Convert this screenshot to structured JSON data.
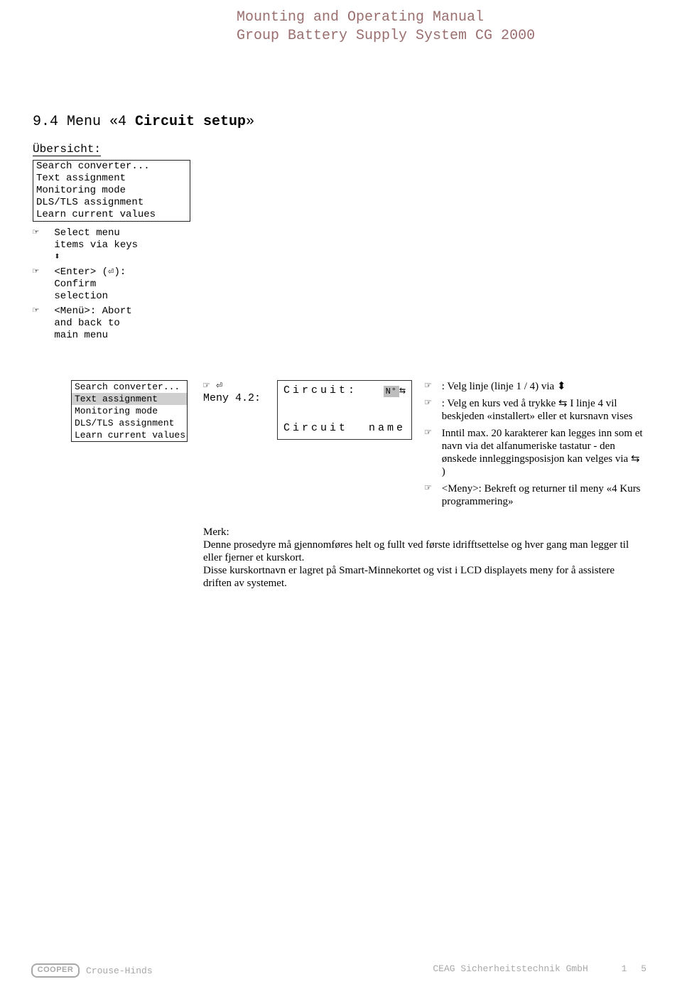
{
  "header": {
    "line1": "Mounting and Operating Manual",
    "line2": "Group Battery Supply System CG 2000"
  },
  "section": {
    "num": "9.4 Menu «4 ",
    "bold": "Circuit setup",
    "close": "»"
  },
  "ubersicht": "Übersicht:",
  "menu1": {
    "r1": "Search converter...",
    "r2": "Text assignment",
    "r3": "Monitoring mode",
    "r4": "DLS/TLS assignment",
    "r5": "Learn current values"
  },
  "bul1": {
    "b1a": "Select menu",
    "b1b": "items via keys",
    "b1c": "⬍",
    "b2a": "<Enter> (⏎):",
    "b2b": "Confirm",
    "b2c": "selection",
    "b3a": "<Menü>: Abort",
    "b3b": "and back to",
    "b3c": "main menu"
  },
  "menu2": {
    "r1": "Search converter...",
    "r2": "Text assignment",
    "r3": "Monitoring mode",
    "r4": "DLS/TLS assignment",
    "r5": "Learn current values"
  },
  "meny": {
    "hand": "☞ ⏎",
    "label": "Meny 4.2:"
  },
  "lcd": {
    "l1_left": "Circuit:",
    "l1_badge": "N°",
    "l1_arrow": "⇆",
    "l2_left": "Circuit",
    "l2_right": "name"
  },
  "rnotes": {
    "n1": ": Velg linje (linje 1 / 4) via  ⬍",
    "n2": ": Velg en kurs ved å trykke  ⇆ I linje 4 vil beskjeden «installert» eller et kursnavn vises",
    "n3": "Inntil max. 20 karakterer kan legges inn som et navn via det alfanumeriske tastatur - den ønskede innleggingsposisjon kan velges via  ⇆ )",
    "n4": "<Meny>: Bekreft og returner til meny «4 Kurs programmering»"
  },
  "merk": {
    "label": "Merk:",
    "p": "Denne prosedyre må gjennomføres helt og fullt ved første idrifftsettelse og hver gang man legger til eller fjerner et kurskort.\nDisse kurskortnavn er lagret på Smart-Minnekortet og vist i LCD displayets meny for å assistere driften av systemet."
  },
  "footer": {
    "cooper": "COOPER",
    "ch": "Crouse-Hinds",
    "right": "CEAG Sicherheitstechnik GmbH",
    "page": "1 5"
  }
}
